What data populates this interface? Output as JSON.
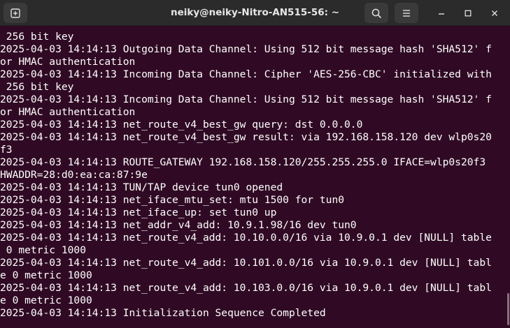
{
  "window": {
    "title": "neiky@neiky-Nitro-AN515-56: ~"
  },
  "terminal": {
    "lines": [
      " 256 bit key",
      "2025-04-03 14:14:13 Outgoing Data Channel: Using 512 bit message hash 'SHA512' f",
      "or HMAC authentication",
      "2025-04-03 14:14:13 Incoming Data Channel: Cipher 'AES-256-CBC' initialized with",
      " 256 bit key",
      "2025-04-03 14:14:13 Incoming Data Channel: Using 512 bit message hash 'SHA512' f",
      "or HMAC authentication",
      "2025-04-03 14:14:13 net_route_v4_best_gw query: dst 0.0.0.0",
      "2025-04-03 14:14:13 net_route_v4_best_gw result: via 192.168.158.120 dev wlp0s20",
      "f3",
      "2025-04-03 14:14:13 ROUTE_GATEWAY 192.168.158.120/255.255.255.0 IFACE=wlp0s20f3",
      "HWADDR=28:d0:ea:ca:87:9e",
      "2025-04-03 14:14:13 TUN/TAP device tun0 opened",
      "2025-04-03 14:14:13 net_iface_mtu_set: mtu 1500 for tun0",
      "2025-04-03 14:14:13 net_iface_up: set tun0 up",
      "2025-04-03 14:14:13 net_addr_v4_add: 10.9.1.98/16 dev tun0",
      "2025-04-03 14:14:13 net_route_v4_add: 10.10.0.0/16 via 10.9.0.1 dev [NULL] table",
      " 0 metric 1000",
      "2025-04-03 14:14:13 net_route_v4_add: 10.101.0.0/16 via 10.9.0.1 dev [NULL] tabl",
      "e 0 metric 1000",
      "2025-04-03 14:14:13 net_route_v4_add: 10.103.0.0/16 via 10.9.0.1 dev [NULL] tabl",
      "e 0 metric 1000",
      "2025-04-03 14:14:13 Initialization Sequence Completed"
    ]
  },
  "icons": {
    "new_tab": "new-tab-icon",
    "search": "search-icon",
    "menu": "hamburger-menu-icon",
    "minimize": "minimize-icon",
    "maximize": "maximize-icon",
    "close": "close-icon"
  },
  "colors": {
    "background": "#300a24",
    "titlebar": "#2b2b2b",
    "text": "#ffffff"
  }
}
